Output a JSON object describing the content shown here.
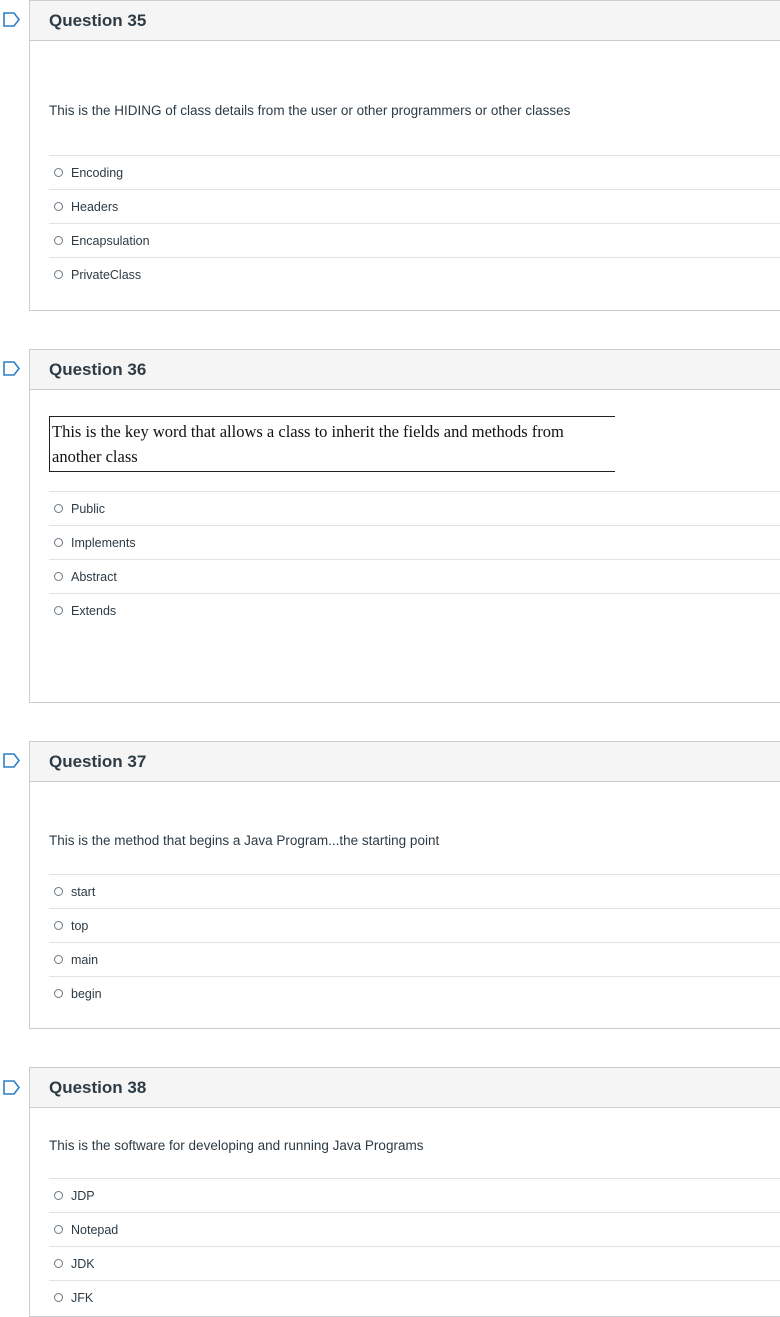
{
  "questions": [
    {
      "title": "Question 35",
      "text": "This is the HIDING of class details from the user or other programmers or other classes",
      "answers": [
        "Encoding",
        "Headers",
        "Encapsulation",
        "PrivateClass"
      ]
    },
    {
      "title": "Question 36",
      "text_line1": "This is the key word that allows a class to inherit the fields and methods from",
      "text_line2": "another class",
      "answers": [
        "Public",
        "Implements",
        "Abstract",
        "Extends"
      ]
    },
    {
      "title": "Question 37",
      "text": "This is the method that begins a Java Program...the starting point",
      "answers": [
        "start",
        "top",
        "main",
        "begin"
      ]
    },
    {
      "title": "Question 38",
      "text": "This is the software for developing and running Java Programs",
      "answers": [
        "JDP",
        "Notepad",
        "JDK",
        "JFK"
      ]
    }
  ],
  "colors": {
    "flag": "#2d7fc9",
    "header_bg": "#f5f5f5",
    "border": "#c7cdd1"
  },
  "icons": {
    "flag": "bookmark-flag-icon",
    "radio": "radio-button-icon"
  }
}
